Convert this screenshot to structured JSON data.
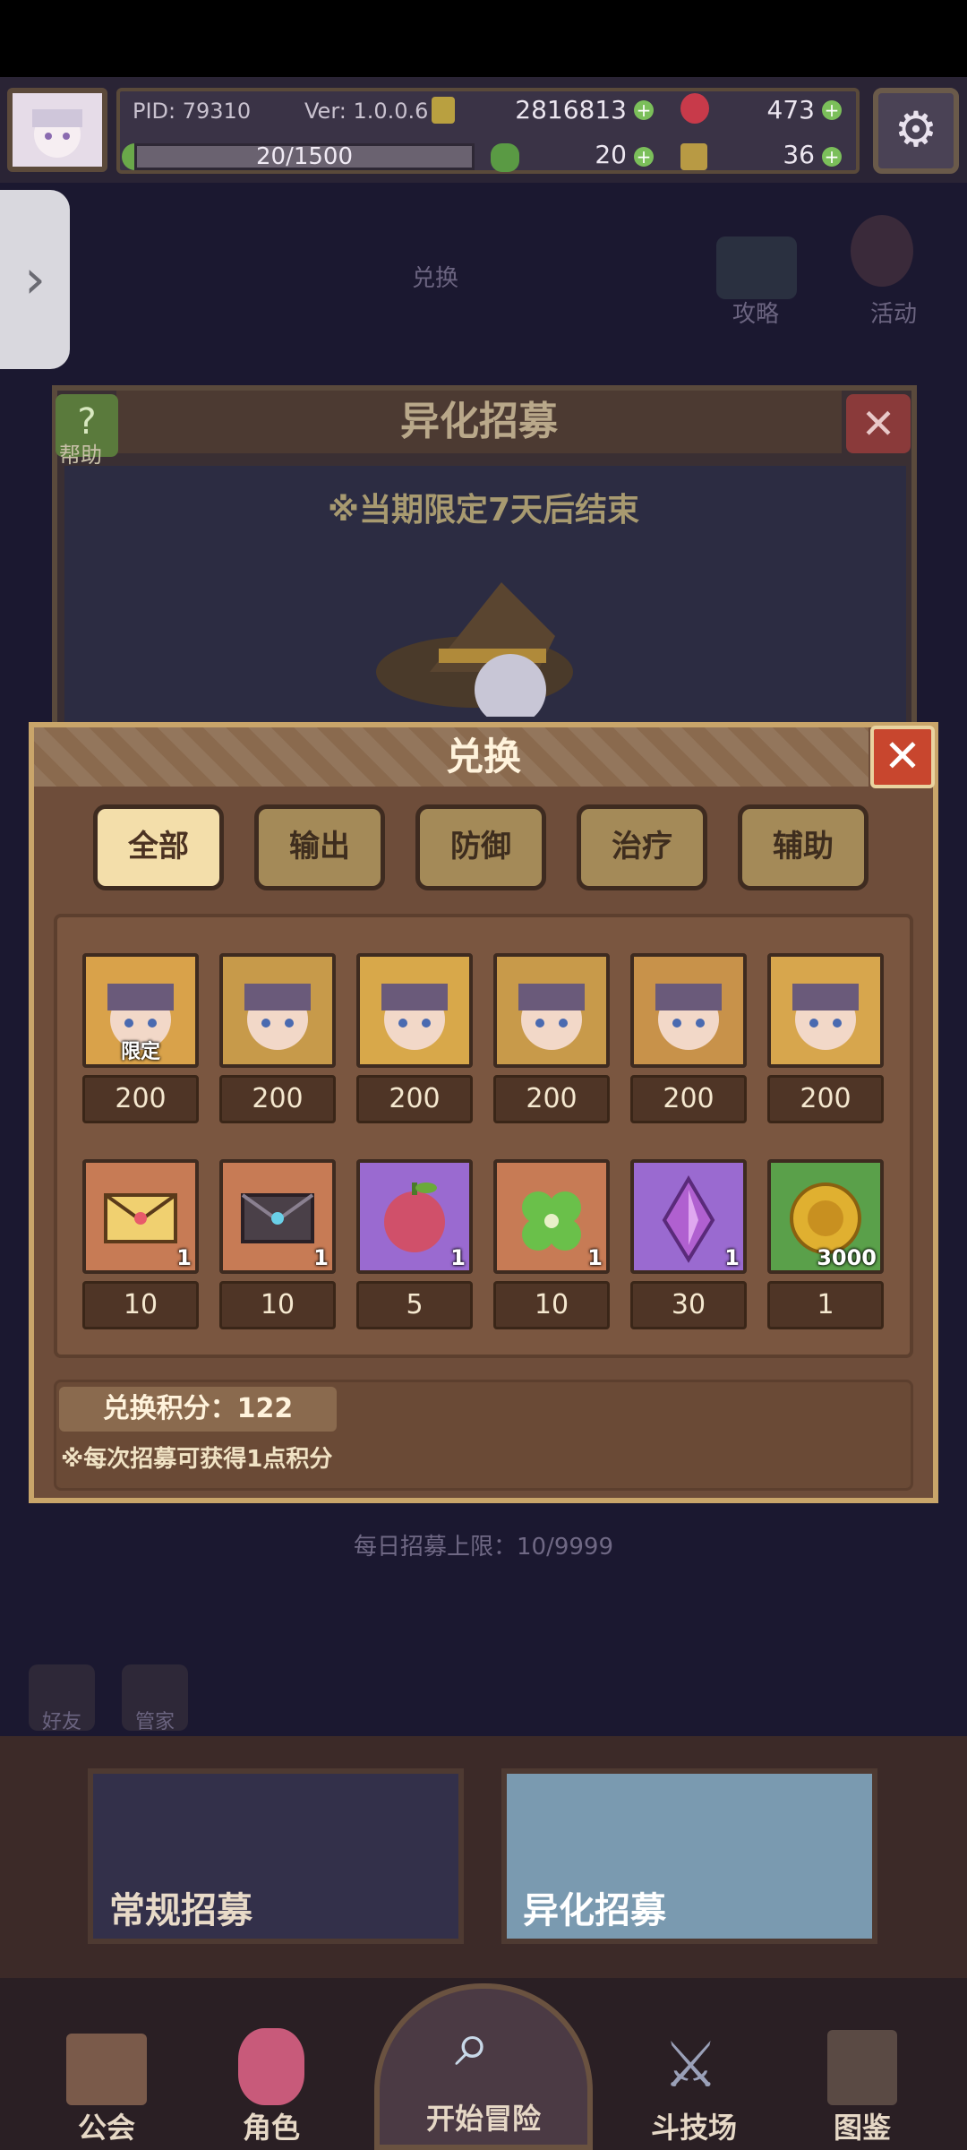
{
  "hud": {
    "pid": "PID: 79310",
    "version": "Ver: 1.0.0.6",
    "gold": "2816813",
    "gems": "473",
    "xp": "20/1500",
    "clover": "20",
    "tickets": "36"
  },
  "background": {
    "exchange_label": "兑换",
    "strategy": "攻略",
    "activity": "活动",
    "help": "帮助",
    "panel_title": "异化招募",
    "notice": "※当期限定7天后结束",
    "daily_limit": "每日招募上限：10/9999",
    "small1": "好友",
    "small2": "管家",
    "recruit_normal": "常规招募",
    "recruit_special": "异化招募"
  },
  "modal": {
    "title": "兑换",
    "tabs": [
      "全部",
      "输出",
      "防御",
      "治疗",
      "辅助"
    ],
    "active_tab": "全部",
    "characters": [
      {
        "price": "200",
        "badge": "限定",
        "color": "#d9a24a"
      },
      {
        "price": "200",
        "badge": "",
        "color": "#c79a4a"
      },
      {
        "price": "200",
        "badge": "",
        "color": "#d8a84a"
      },
      {
        "price": "200",
        "badge": "",
        "color": "#c89a4a"
      },
      {
        "price": "200",
        "badge": "",
        "color": "#c8924a"
      },
      {
        "price": "200",
        "badge": "",
        "color": "#d7a64d"
      }
    ],
    "items": [
      {
        "icon": "gold-envelope-icon",
        "qty": "1",
        "price": "10"
      },
      {
        "icon": "dark-envelope-icon",
        "qty": "1",
        "price": "10"
      },
      {
        "icon": "fruit-icon",
        "qty": "1",
        "price": "5"
      },
      {
        "icon": "clover-icon",
        "qty": "1",
        "price": "10"
      },
      {
        "icon": "crystal-icon",
        "qty": "1",
        "price": "30"
      },
      {
        "icon": "gold-coin-icon",
        "qty": "3000",
        "price": "1"
      }
    ],
    "points": "兑换积分：122",
    "points_note": "※每次招募可获得1点积分"
  },
  "nav": {
    "guild": "公会",
    "character": "角色",
    "adventure": "开始冒险",
    "arena": "斗技场",
    "gallery": "图鉴"
  }
}
